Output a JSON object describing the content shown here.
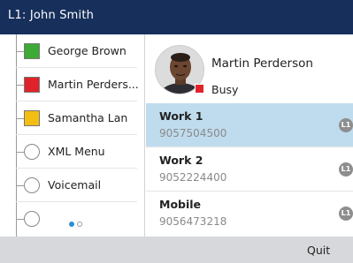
{
  "titlebar": {
    "line_title": "L1: John Smith"
  },
  "lines": [
    {
      "label": "George Brown",
      "indicator": "square",
      "color": "#3daa35"
    },
    {
      "label": "Martin Perders...",
      "indicator": "square",
      "color": "#e0232a"
    },
    {
      "label": "Samantha Lan",
      "indicator": "square",
      "color": "#f2be12"
    },
    {
      "label": "XML Menu",
      "indicator": "circle"
    },
    {
      "label": "Voicemail",
      "indicator": "circle"
    },
    {
      "label": "",
      "indicator": "circle"
    }
  ],
  "pager": {
    "pages": 2,
    "current": 1
  },
  "contact": {
    "name": "Martin Perderson",
    "status": "Busy",
    "status_color": "#e0232a"
  },
  "numbers": [
    {
      "label": "Work 1",
      "number": "9057504500",
      "line_badge": "L1",
      "selected": true
    },
    {
      "label": "Work 2",
      "number": "9052224400",
      "line_badge": "L1",
      "selected": false
    },
    {
      "label": "Mobile",
      "number": "9056473218",
      "line_badge": "L1",
      "selected": false
    }
  ],
  "softkeys": {
    "quit": "Quit"
  }
}
